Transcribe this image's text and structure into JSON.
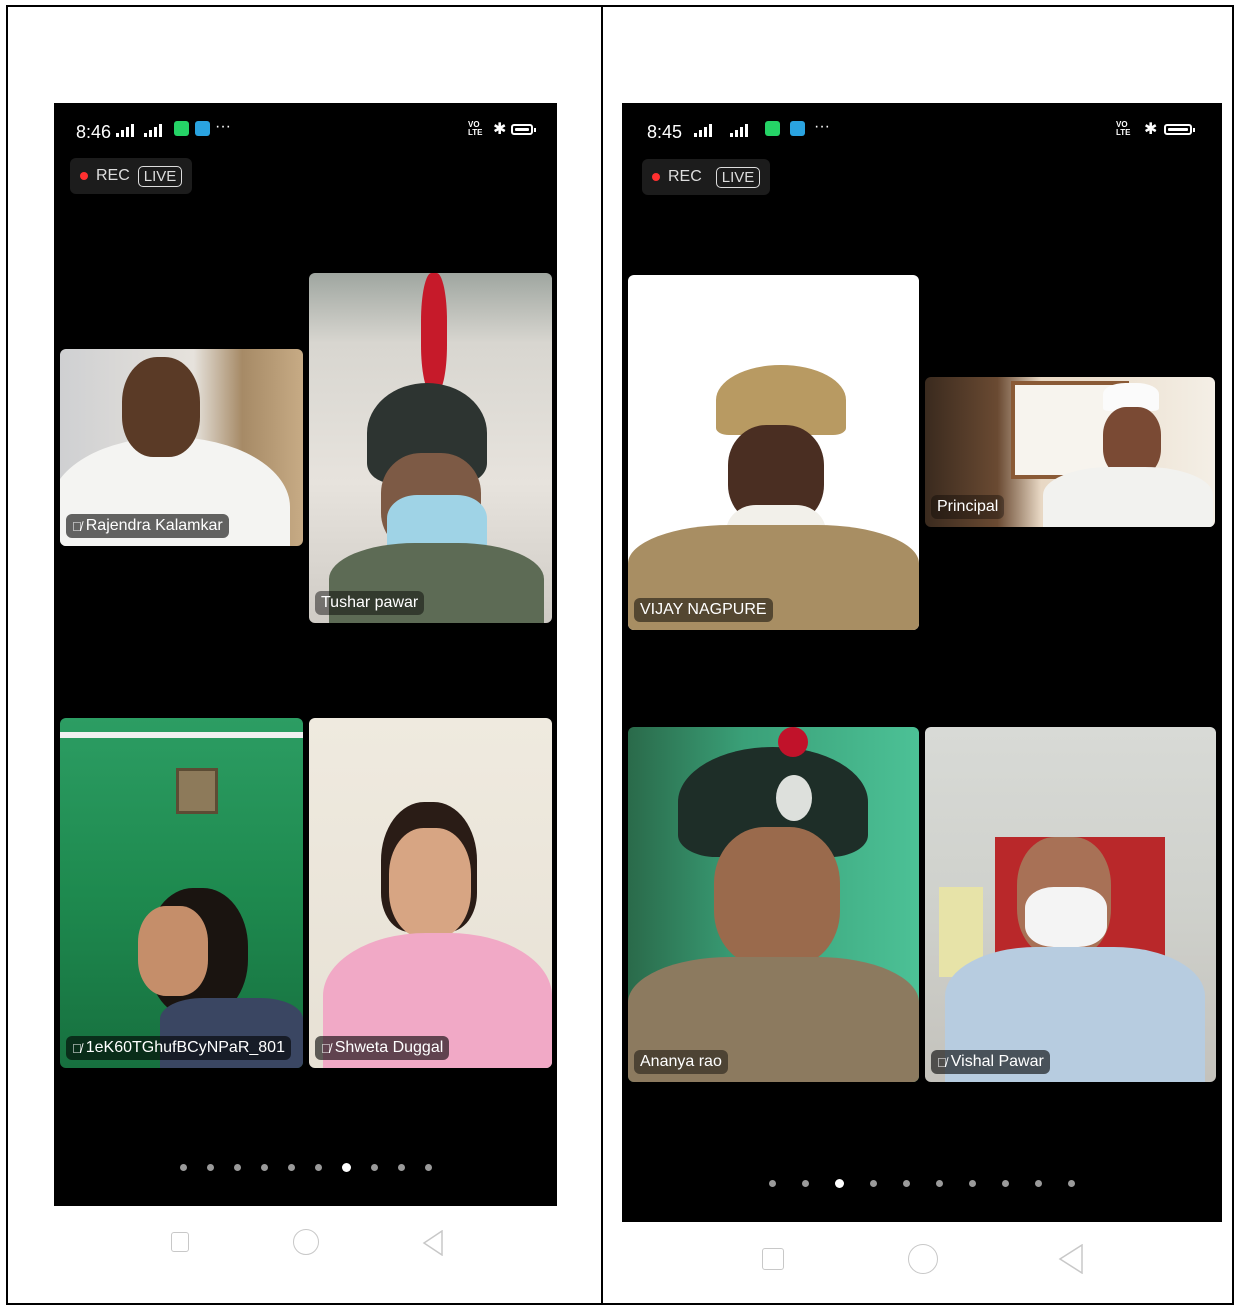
{
  "screens": [
    {
      "status": {
        "time": "8:46",
        "volte": "VO\nLTE"
      },
      "rec_label": "REC",
      "live_label": "LIVE",
      "participants": [
        {
          "name": "Rajendra Kalamkar",
          "muted": true
        },
        {
          "name": "Tushar pawar",
          "muted": false
        },
        {
          "name": "1eK60TGhufBCyNPaR_801",
          "muted": true
        },
        {
          "name": "Shweta Duggal",
          "muted": true
        }
      ],
      "page_count": 10,
      "active_page": 7
    },
    {
      "status": {
        "time": "8:45",
        "volte": "VO\nLTE"
      },
      "rec_label": "REC",
      "live_label": "LIVE",
      "participants": [
        {
          "name": "VIJAY NAGPURE",
          "muted": false
        },
        {
          "name": "Principal",
          "muted": false
        },
        {
          "name": "Ananya rao",
          "muted": false
        },
        {
          "name": "Vishal Pawar",
          "muted": true
        }
      ],
      "page_count": 10,
      "active_page": 3
    }
  ],
  "colors": {
    "background": "#000000",
    "rec_dot": "#ff3030",
    "whatsapp": "#25d366",
    "telegram": "#2aa3e0"
  },
  "icons": [
    "signal-icon",
    "whatsapp-icon",
    "telegram-icon",
    "bluetooth-icon",
    "battery-icon",
    "mic-muted-icon",
    "nav-recents-icon",
    "nav-home-icon",
    "nav-back-icon"
  ]
}
